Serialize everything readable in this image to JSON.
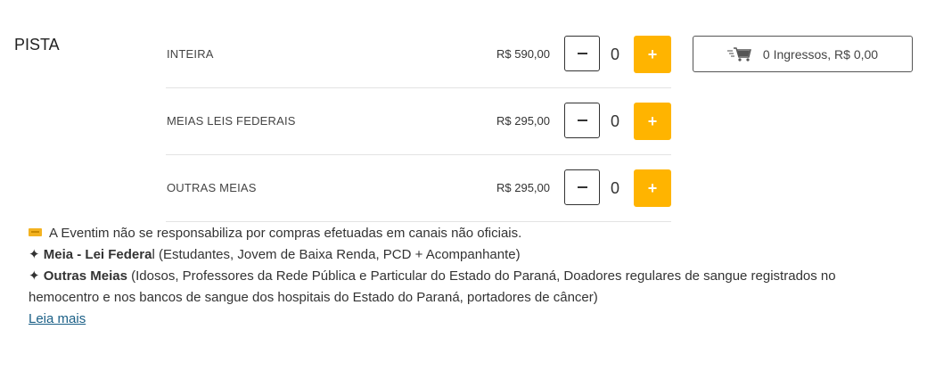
{
  "section": {
    "title": "PISTA"
  },
  "tickets": [
    {
      "name": "INTEIRA",
      "price": "R$ 590,00",
      "quantity": "0"
    },
    {
      "name": "MEIAS LEIS FEDERAIS",
      "price": "R$ 295,00",
      "quantity": "0"
    },
    {
      "name": "OUTRAS MEIAS",
      "price": "R$ 295,00",
      "quantity": "0"
    }
  ],
  "stepper": {
    "minus_symbol": "−",
    "plus_symbol": "+"
  },
  "cart": {
    "label": "0 Ingressos, R$ 0,00",
    "icon": "cart-icon"
  },
  "notes": {
    "disclaimer": "A Eventim não se responsabiliza por compras efetuadas em canais não oficiais.",
    "meia_bullet": "✦ ",
    "meia_bold_1": "Meia - Lei Federa",
    "meia_tail": "l (Estudantes, Jovem de Baixa Renda, PCD + Acompanhante)",
    "outras_bullet": "✦ ",
    "outras_bold": "Outras Meias",
    "outras_text": " (Idosos, Professores da Rede Pública e Particular do Estado do Paraná, Doadores regulares de sangue registrados no hemocentro e nos bancos de sangue dos hospitais do Estado do Paraná, portadores de câncer)",
    "read_more": "Leia mais"
  },
  "colors": {
    "accent": "#ffb400",
    "link": "#1a5f86"
  }
}
